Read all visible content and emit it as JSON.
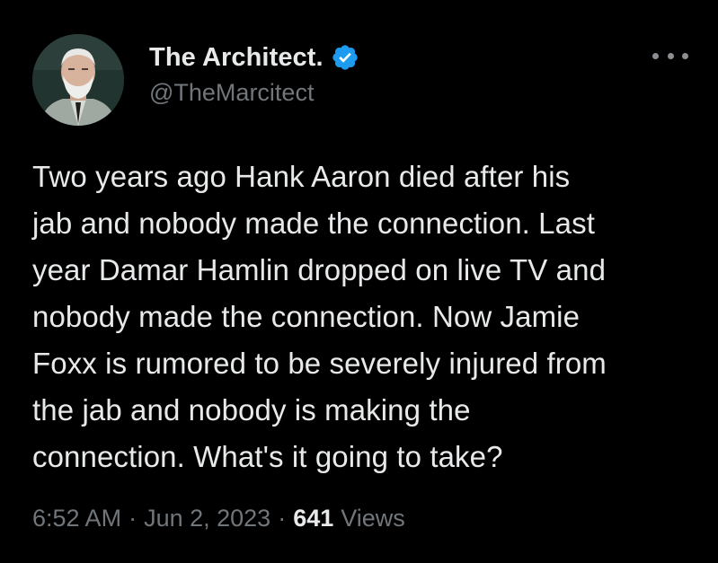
{
  "author": {
    "display_name": "The Architect.",
    "handle": "@TheMarcitect",
    "verified": true
  },
  "tweet": {
    "lines": [
      "Two years ago Hank Aaron died after his",
      "jab and nobody made the connection. Last",
      "year Damar Hamlin dropped on live TV and",
      "nobody made the connection. Now Jamie",
      "Foxx is rumored to be severely injured from",
      "the jab and nobody is making the",
      "connection. What's it going to take?"
    ]
  },
  "meta": {
    "time": "6:52 AM",
    "separator": "·",
    "date": "Jun 2, 2023",
    "views_count": "641",
    "views_label": "Views"
  },
  "icons": {
    "verified": "verified-badge-icon",
    "more": "more-options-icon"
  },
  "colors": {
    "background": "#000000",
    "primary_text": "#e7e9ea",
    "secondary_text": "#71767b",
    "verified_blue": "#1d9bf0"
  }
}
